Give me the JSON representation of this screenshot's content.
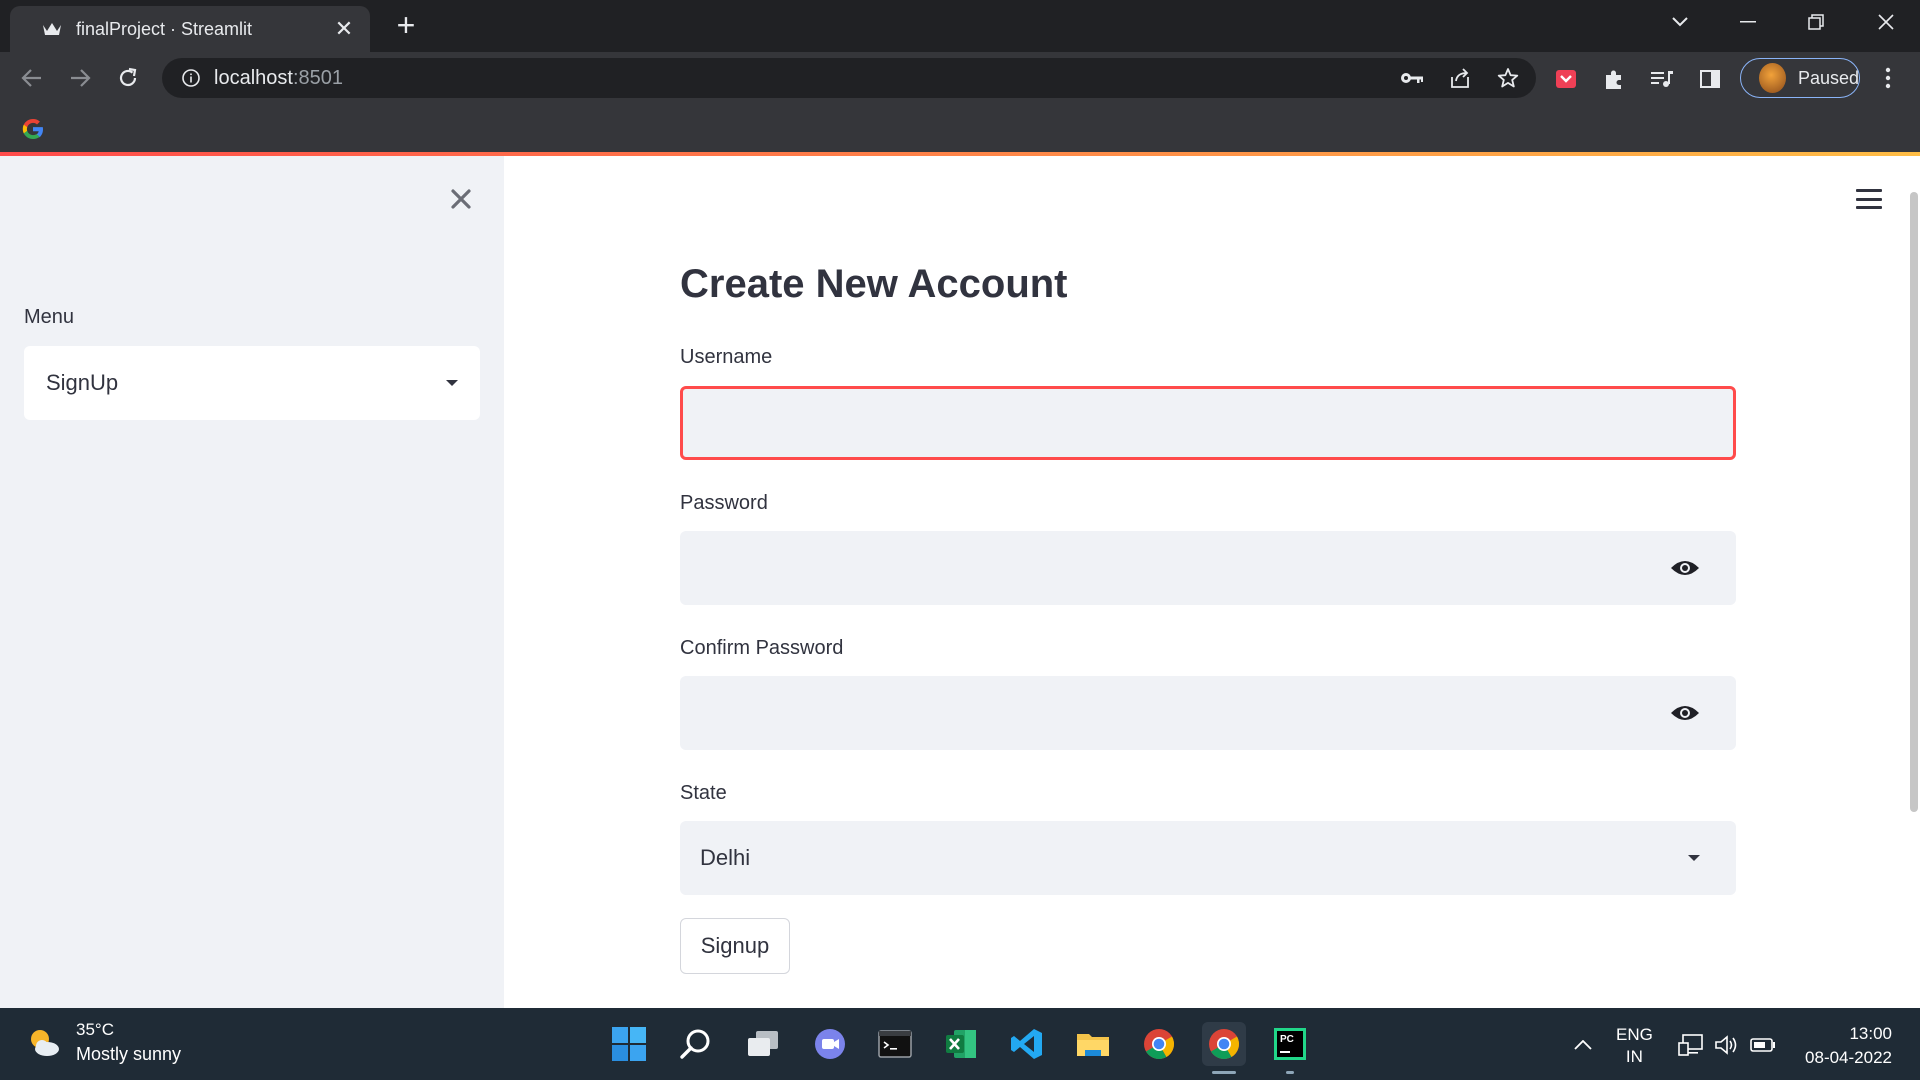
{
  "browser": {
    "tab_title": "finalProject · Streamlit",
    "url_host": "localhost",
    "url_port": ":8501",
    "profile_status": "Paused"
  },
  "sidebar": {
    "menu_label": "Menu",
    "menu_selected": "SignUp"
  },
  "main": {
    "title": "Create New Account",
    "username_label": "Username",
    "username_value": "",
    "password_label": "Password",
    "password_value": "",
    "confirm_label": "Confirm Password",
    "confirm_value": "",
    "state_label": "State",
    "state_selected": "Delhi",
    "signup_button": "Signup"
  },
  "taskbar": {
    "weather_temp": "35°C",
    "weather_desc": "Mostly sunny",
    "lang_line1": "ENG",
    "lang_line2": "IN",
    "time": "13:00",
    "date": "08-04-2022"
  },
  "colors": {
    "accent": "#ff4b4b",
    "sidebar_bg": "#f0f2f6",
    "chrome_dark": "#202124",
    "chrome_toolbar": "#35363a",
    "taskbar": "#1f2b36"
  }
}
